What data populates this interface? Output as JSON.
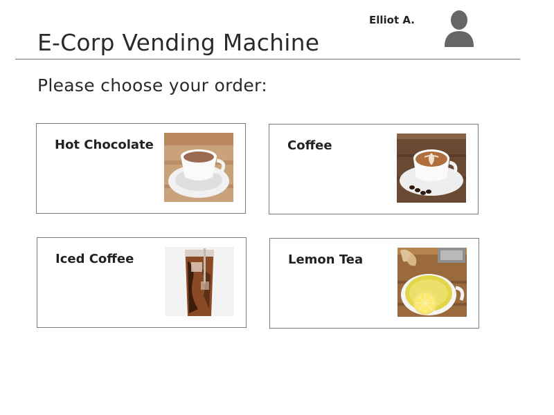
{
  "header": {
    "title": "E-Corp Vending Machine",
    "user_name": "Elliot A.",
    "avatar_icon": "user-silhouette-icon"
  },
  "main": {
    "prompt": "Please choose your order:",
    "items": [
      {
        "label": "Hot Chocolate",
        "image": "hot-chocolate-photo"
      },
      {
        "label": "Coffee",
        "image": "coffee-latte-photo"
      },
      {
        "label": "Iced Coffee",
        "image": "iced-coffee-photo"
      },
      {
        "label": "Lemon Tea",
        "image": "lemon-tea-photo"
      }
    ]
  },
  "colors": {
    "text": "#2a2a2a",
    "border": "#7a7a7a",
    "avatar": "#666666"
  }
}
